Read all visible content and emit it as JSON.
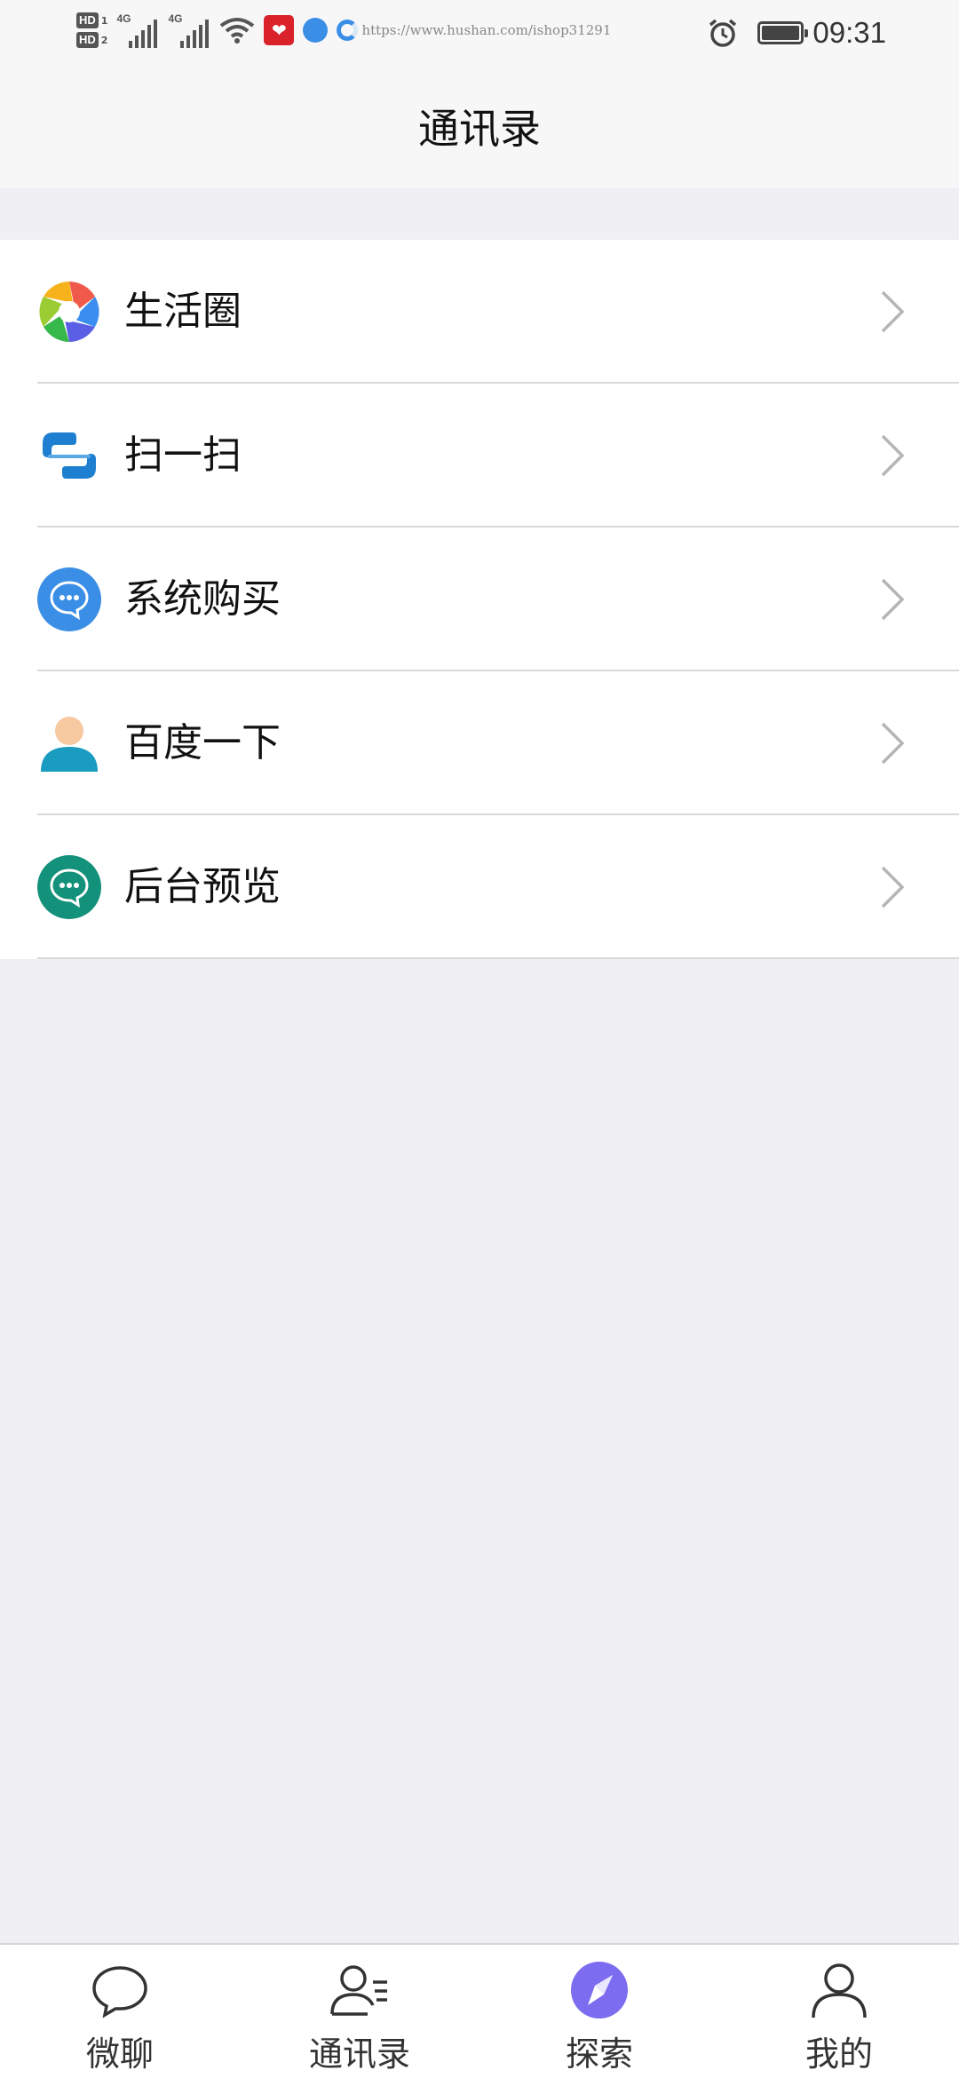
{
  "status_bar": {
    "hd1": "HD",
    "hd1_num": "1",
    "hd2": "HD",
    "hd2_num": "2",
    "sim1_type": "4G",
    "sim2_type": "4G",
    "url": "https://www.hushan.com/ishop31291",
    "time": "09:31"
  },
  "header": {
    "title": "通讯录"
  },
  "menu": [
    {
      "label": "生活圈",
      "icon": "aperture-icon"
    },
    {
      "label": "扫一扫",
      "icon": "scan-icon"
    },
    {
      "label": "系统购买",
      "icon": "chat-bubble-blue-icon"
    },
    {
      "label": "百度一下",
      "icon": "person-icon"
    },
    {
      "label": "后台预览",
      "icon": "chat-bubble-green-icon"
    }
  ],
  "tabs": [
    {
      "label": "微聊",
      "icon": "chat-icon",
      "active": false
    },
    {
      "label": "通讯录",
      "icon": "contacts-icon",
      "active": false
    },
    {
      "label": "探索",
      "icon": "compass-icon",
      "active": true
    },
    {
      "label": "我的",
      "icon": "user-icon",
      "active": false
    }
  ],
  "colors": {
    "accent": "#7c6cf0",
    "background": "#efeff4",
    "blue_icon": "#3a8ee6",
    "green_icon": "#14917a"
  }
}
